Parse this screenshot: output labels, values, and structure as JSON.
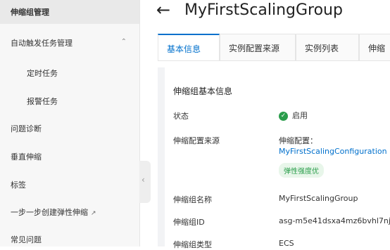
{
  "sidebar": {
    "active": "伸缩组管理",
    "auto_trigger": "自动触发任务管理",
    "scheduled": "定时任务",
    "alarm": "报警任务",
    "diagnosis": "问题诊断",
    "vertical": "垂直伸缩",
    "tags": "标签",
    "step_by_step": "一步一步创建弹性伸缩",
    "faq": "常见问题"
  },
  "header": {
    "title": "MyFirstScalingGroup"
  },
  "tabs": [
    {
      "label": "基本信息"
    },
    {
      "label": "实例配置来源"
    },
    {
      "label": "实例列表"
    },
    {
      "label": "伸缩"
    }
  ],
  "card": {
    "title": "伸缩组基本信息",
    "status_label": "状态",
    "status_value": "启用",
    "config_source_label": "伸缩配置来源",
    "config_prefix": "伸缩配置：",
    "config_link": "MyFirstScalingConfiguration",
    "badge": "弹性强度优",
    "name_label": "伸缩组名称",
    "name_value": "MyFirstScalingGroup",
    "id_label": "伸缩组ID",
    "id_value": "asg-m5e41dsxa4mz6bvhl7nj",
    "type_label": "伸缩组类型",
    "type_value": "ECS"
  }
}
